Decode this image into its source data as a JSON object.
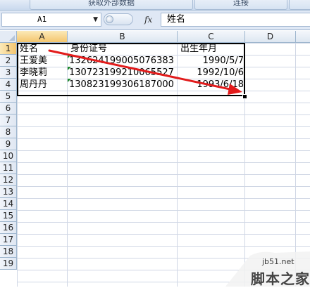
{
  "ribbon": {
    "get_external_data": "获取外部数据",
    "connections": "连接"
  },
  "formula_bar": {
    "name_box": "A1",
    "fx_label": "fx",
    "content": "姓名"
  },
  "columns": [
    "A",
    "B",
    "C",
    "D"
  ],
  "rows": [
    "1",
    "2",
    "3",
    "4",
    "5",
    "6",
    "7",
    "8",
    "9",
    "10",
    "11",
    "12",
    "13",
    "14",
    "15",
    "16",
    "17",
    "18",
    "19"
  ],
  "sheet": {
    "headers": {
      "a": "姓名",
      "b": "身份证号",
      "c": "出生年月"
    },
    "records": [
      {
        "name": "王爱美",
        "id": "132624199005076383",
        "dob": "1990/5/7"
      },
      {
        "name": "李晓莉",
        "id": "130723199210065527",
        "dob": "1992/10/6"
      },
      {
        "name": "周丹丹",
        "id": "130823199306187000",
        "dob": "1993/6/18"
      }
    ]
  },
  "annotation_color": "#e21b1b",
  "watermark": {
    "site": "jb51.net",
    "brand": "脚本之家"
  }
}
